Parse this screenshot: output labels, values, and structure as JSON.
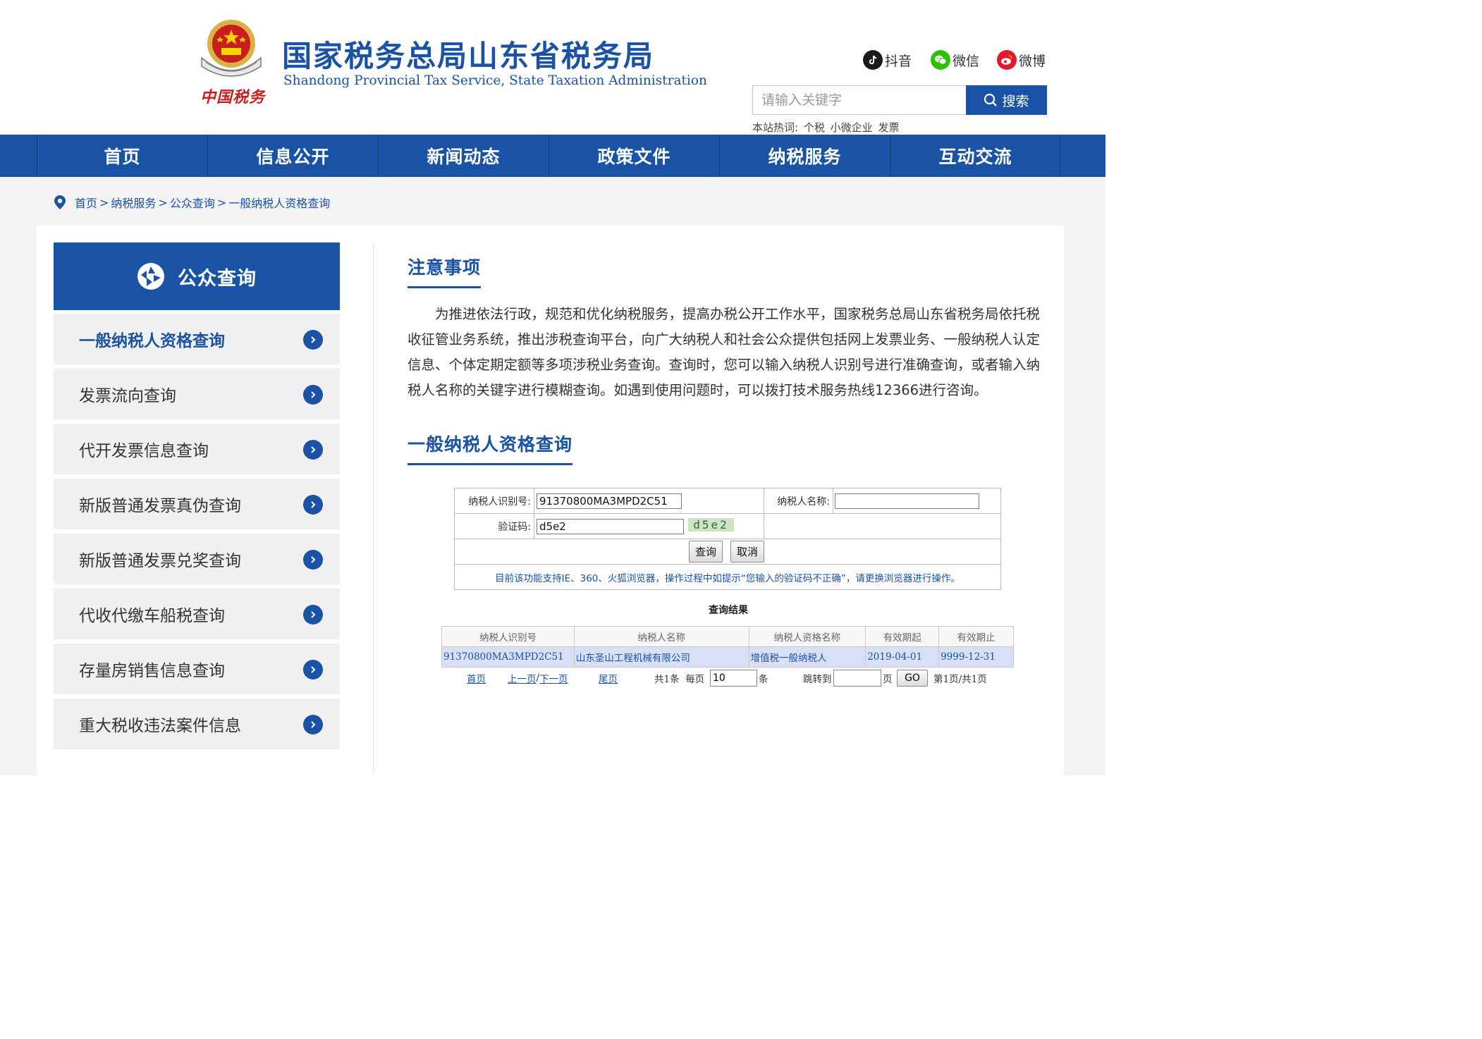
{
  "header": {
    "logo_script": "中国税务",
    "title_cn": "国家税务总局山东省税务局",
    "title_en": "Shandong Provincial Tax Service, State Taxation Administration",
    "social": {
      "douyin": "抖音",
      "wechat": "微信",
      "weibo": "微博"
    },
    "search": {
      "placeholder": "请输入关键字",
      "button_label": "搜索"
    },
    "hot_words": {
      "label": "本站热词:",
      "items": [
        "个税",
        "小微企业",
        "发票"
      ]
    }
  },
  "nav": {
    "items": [
      {
        "label": "首页"
      },
      {
        "label": "信息公开"
      },
      {
        "label": "新闻动态"
      },
      {
        "label": "政策文件"
      },
      {
        "label": "纳税服务"
      },
      {
        "label": "互动交流"
      }
    ]
  },
  "breadcrumb": {
    "separator": ">",
    "items": [
      "首页",
      "纳税服务",
      "公众查询",
      "一般纳税人资格查询"
    ]
  },
  "sidebar": {
    "title": "公众查询",
    "items": [
      {
        "label": "一般纳税人资格查询",
        "active": true
      },
      {
        "label": "发票流向查询",
        "active": false
      },
      {
        "label": "代开发票信息查询",
        "active": false
      },
      {
        "label": "新版普通发票真伪查询",
        "active": false
      },
      {
        "label": "新版普通发票兑奖查询",
        "active": false
      },
      {
        "label": "代收代缴车船税查询",
        "active": false
      },
      {
        "label": "存量房销售信息查询",
        "active": false
      },
      {
        "label": "重大税收违法案件信息",
        "active": false
      }
    ]
  },
  "notice": {
    "title": "注意事项",
    "body": "为推进依法行政，规范和优化纳税服务，提高办税公开工作水平，国家税务总局山东省税务局依托税收征管业务系统，推出涉税查询平台，向广大纳税人和社会公众提供包括网上发票业务、一般纳税人认定信息、个体定期定额等多项涉税业务查询。查询时，您可以输入纳税人识别号进行准确查询，或者输入纳税人名称的关键字进行模糊查询。如遇到使用问题时，可以拨打技术服务热线12366进行咨询。"
  },
  "query": {
    "title": "一般纳税人资格查询",
    "taxpayer_id_label": "纳税人识别号:",
    "taxpayer_id_value": "91370800MA3MPD2C51",
    "taxpayer_name_label": "纳税人名称:",
    "taxpayer_name_value": "",
    "captcha_label": "验证码:",
    "captcha_value": "d5e2",
    "captcha_image_text": "d5e2",
    "submit_label": "查询",
    "cancel_label": "取消",
    "browser_tip": "目前该功能支持IE、360、火狐浏览器，操作过程中如提示“您输入的验证码不正确”，请更换浏览器进行操作。"
  },
  "results": {
    "title": "查询结果",
    "columns": [
      "纳税人识别号",
      "纳税人名称",
      "纳税人资格名称",
      "有效期起",
      "有效期止"
    ],
    "rows": [
      [
        "91370800MA3MPD2C51",
        "山东圣山工程机械有限公司",
        "增值税一般纳税人",
        "2019-04-01",
        "9999-12-31"
      ]
    ]
  },
  "pager": {
    "first": "首页",
    "prev": "上一页",
    "slash": "/",
    "next": "下一页",
    "last": "尾页",
    "total": "共1条",
    "per_page_label": "每页",
    "per_page_value": "10",
    "per_page_unit": "条",
    "jump_label": "跳转到",
    "jump_value": "",
    "page_unit": "页",
    "go_label": "GO",
    "page_status": "第1页/共1页"
  },
  "colors": {
    "brand_blue": "#1a52a6",
    "emblem_red": "#c81e1e",
    "result_row_bg": "#d7e0f5"
  }
}
